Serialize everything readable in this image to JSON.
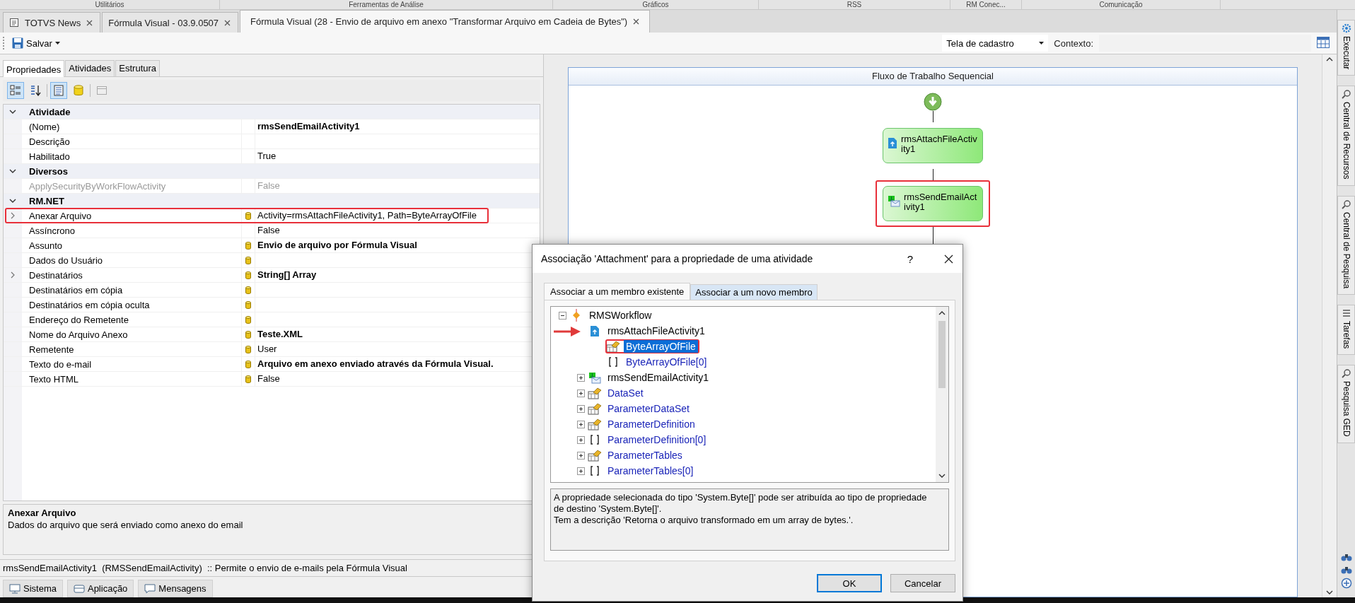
{
  "menu_strip": [
    "Utilitários",
    "Ferramentas de Análise",
    "Gráficos",
    "RSS",
    "RM Conec...",
    "Comunicação"
  ],
  "document_tabs": [
    {
      "label": "TOTVS News",
      "selected": false,
      "has_icon": true
    },
    {
      "label": "Fórmula Visual - 03.9.0507",
      "selected": false,
      "has_icon": false
    },
    {
      "label": "Fórmula Visual (28 - Envio de arquivo em anexo \"Transformar Arquivo em Cadeia de Bytes\")",
      "selected": true,
      "has_icon": false
    }
  ],
  "toolbar": {
    "save_label": "Salvar",
    "view_mode": "Tela de cadastro",
    "context_label": "Contexto:"
  },
  "property_tabs": [
    {
      "label": "Propriedades",
      "selected": true
    },
    {
      "label": "Atividades",
      "selected": false
    },
    {
      "label": "Estrutura",
      "selected": false
    }
  ],
  "grid_toolbar": [
    {
      "kind": "categorized",
      "pressed": true
    },
    {
      "kind": "alphabetical",
      "pressed": false
    },
    {
      "kind": "properties",
      "pressed": true
    },
    {
      "kind": "bindings",
      "pressed": false
    },
    {
      "kind": "pages",
      "pressed": false
    }
  ],
  "property_grid": [
    {
      "category": "Atividade",
      "expanded": true,
      "rows": [
        {
          "name": "(Nome)",
          "value": "rmsSendEmailActivity1",
          "non_default": true,
          "bound": false,
          "expandable": false,
          "disabled": false
        },
        {
          "name": "Descrição",
          "bound": false,
          "expandable": false,
          "disabled": false
        },
        {
          "name": "Habilitado",
          "value": "True",
          "non_default": false,
          "bound": false,
          "expandable": false,
          "disabled": false
        }
      ]
    },
    {
      "category": "Diversos",
      "expanded": true,
      "rows": [
        {
          "name": "ApplySecurityByWorkFlowActivity",
          "value": "False",
          "non_default": false,
          "bound": false,
          "expandable": false,
          "disabled": true
        }
      ]
    },
    {
      "category": "RM.NET",
      "expanded": true,
      "rows": [
        {
          "name": "Anexar Arquivo",
          "value": "Activity=rmsAttachFileActivity1, Path=ByteArrayOfFile",
          "non_default": false,
          "bound": true,
          "expandable": true,
          "disabled": false,
          "highlighted": true
        },
        {
          "name": "Assíncrono",
          "value": "False",
          "non_default": false,
          "bound": false,
          "expandable": false,
          "disabled": false
        },
        {
          "name": "Assunto",
          "value": "Envio de arquivo por Fórmula Visual",
          "non_default": true,
          "bound": true,
          "expandable": false,
          "disabled": false
        },
        {
          "name": "Dados do Usuário",
          "bound": true,
          "expandable": false,
          "disabled": false
        },
        {
          "name": "Destinatários",
          "value": "String[] Array",
          "non_default": true,
          "bound": true,
          "expandable": true,
          "disabled": false
        },
        {
          "name": "Destinatários em cópia",
          "bound": true,
          "expandable": false,
          "disabled": false
        },
        {
          "name": "Destinatários em cópia oculta",
          "bound": true,
          "expandable": false,
          "disabled": false
        },
        {
          "name": "Endereço do Remetente",
          "bound": true,
          "expandable": false,
          "disabled": false
        },
        {
          "name": "Nome do Arquivo Anexo",
          "value": "Teste.XML",
          "non_default": true,
          "bound": true,
          "expandable": false,
          "disabled": false
        },
        {
          "name": "Remetente",
          "value": "User",
          "non_default": false,
          "bound": true,
          "expandable": false,
          "disabled": false
        },
        {
          "name": "Texto do e-mail",
          "value": "Arquivo em anexo enviado através da Fórmula Visual.",
          "non_default": true,
          "bound": true,
          "expandable": false,
          "disabled": false
        },
        {
          "name": "Texto HTML",
          "value": "False",
          "non_default": false,
          "bound": true,
          "expandable": false,
          "disabled": false
        }
      ]
    }
  ],
  "property_description": {
    "title": "Anexar Arquivo",
    "text": "Dados do arquivo que será enviado como anexo do email"
  },
  "status_text": "rmsSendEmailActivity1  (RMSSendEmailActivity)  :: Permite o envio de e-mails pela Fórmula Visual",
  "bottom_tabs": [
    {
      "label": "Sistema",
      "kind": "system"
    },
    {
      "label": "Aplicação",
      "kind": "application"
    },
    {
      "label": "Mensagens",
      "kind": "messages"
    }
  ],
  "side_panels": [
    {
      "label": "Executar",
      "kind": "run"
    },
    {
      "label": "Central de Recursos",
      "kind": "search"
    },
    {
      "label": "Central de Pesquisa",
      "kind": "search"
    },
    {
      "label": "Tarefas",
      "kind": "tasks"
    },
    {
      "label": "Pesquisa GED",
      "kind": "search"
    }
  ],
  "workflow": {
    "title": "Fluxo de Trabalho Sequencial",
    "nodes": [
      {
        "label": "rmsAttachFileActivity1",
        "kind": "attach"
      },
      {
        "label": "rmsSendEmailActivity1",
        "kind": "email",
        "highlighted": true
      }
    ]
  },
  "dialog": {
    "title": "Associação 'Attachment' para a propriedade de uma atividade",
    "help": "?",
    "tabs": [
      {
        "label": "Associar a um membro existente",
        "selected": true,
        "hovered": false
      },
      {
        "label": "Associar a um novo membro",
        "selected": false,
        "hovered": true
      }
    ],
    "tree": [
      {
        "label": "RMSWorkflow",
        "kind": "root",
        "expanded": true,
        "selected": false,
        "children": [
          {
            "label": "rmsAttachFileActivity1",
            "kind": "attach",
            "selected": false,
            "pointer_arrow": true,
            "children": [
              {
                "label": "ByteArrayOfFile",
                "kind": "member",
                "selected": true,
                "highlighted": true
              },
              {
                "label": "ByteArrayOfFile[0]",
                "kind": "array",
                "selected": false
              }
            ]
          },
          {
            "label": "rmsSendEmailActivity1",
            "kind": "email",
            "expanded": false,
            "selected": false
          },
          {
            "label": "DataSet",
            "kind": "member",
            "expanded": false,
            "selected": false
          },
          {
            "label": "ParameterDataSet",
            "kind": "member",
            "expanded": false,
            "selected": false
          },
          {
            "label": "ParameterDefinition",
            "kind": "member",
            "expanded": false,
            "selected": false
          },
          {
            "label": "ParameterDefinition[0]",
            "kind": "array",
            "expanded": false,
            "selected": false
          },
          {
            "label": "ParameterTables",
            "kind": "member",
            "expanded": false,
            "selected": false
          },
          {
            "label": "ParameterTables[0]",
            "kind": "array",
            "expanded": false,
            "selected": false
          }
        ]
      }
    ],
    "description": [
      "A propriedade selecionada do tipo 'System.Byte[]' pode ser atribuída ao tipo de propriedade de destino 'System.Byte[]'.",
      "Tem a descrição 'Retorna o arquivo transformado em um array de bytes.'."
    ],
    "buttons": [
      {
        "label": "OK",
        "default": true
      },
      {
        "label": "Cancelar",
        "default": false
      }
    ]
  }
}
